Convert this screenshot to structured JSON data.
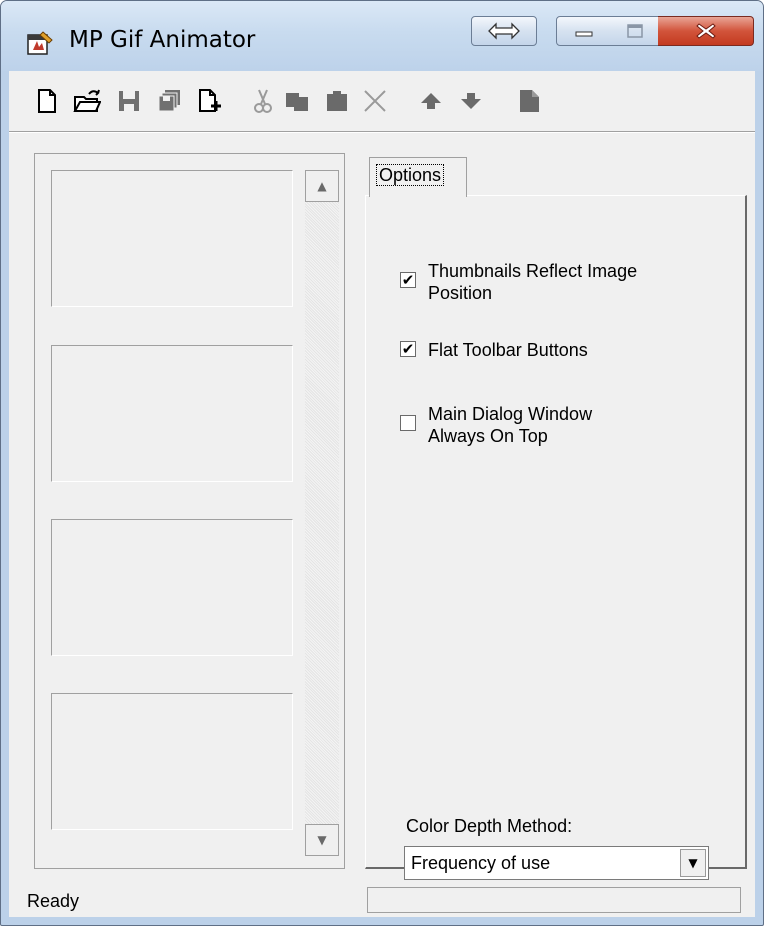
{
  "window": {
    "title": "MP Gif Animator"
  },
  "titlebar_buttons": {
    "resize_icon": "double-arrow-icon",
    "minimize_icon": "minimize-icon",
    "maximize_icon": "maximize-icon",
    "close_icon": "close-icon"
  },
  "toolbar": {
    "tools": [
      "new-file-icon",
      "open-folder-icon",
      "save-icon",
      "save-all-icon",
      "insert-image-icon",
      "cut-icon",
      "copy-icon",
      "paste-icon",
      "delete-icon",
      "move-up-icon",
      "move-down-icon",
      "properties-icon"
    ]
  },
  "tabs": [
    {
      "label": "Options"
    }
  ],
  "options": {
    "checkboxes": [
      {
        "label": "Thumbnails Reflect Image Position",
        "checked": true,
        "check_mark": "✔"
      },
      {
        "label": "Flat Toolbar Buttons",
        "checked": true,
        "check_mark": "✔"
      },
      {
        "label": "Main Dialog Window Always On Top",
        "checked": false,
        "check_mark": ""
      }
    ],
    "color_depth_label": "Color Depth Method:",
    "color_depth_value": "Frequency of use"
  },
  "status": {
    "text": "Ready"
  },
  "colors": {
    "titlebar": "#bcd1e9",
    "close_button": "#c9462c",
    "face": "#f0f0f0"
  }
}
